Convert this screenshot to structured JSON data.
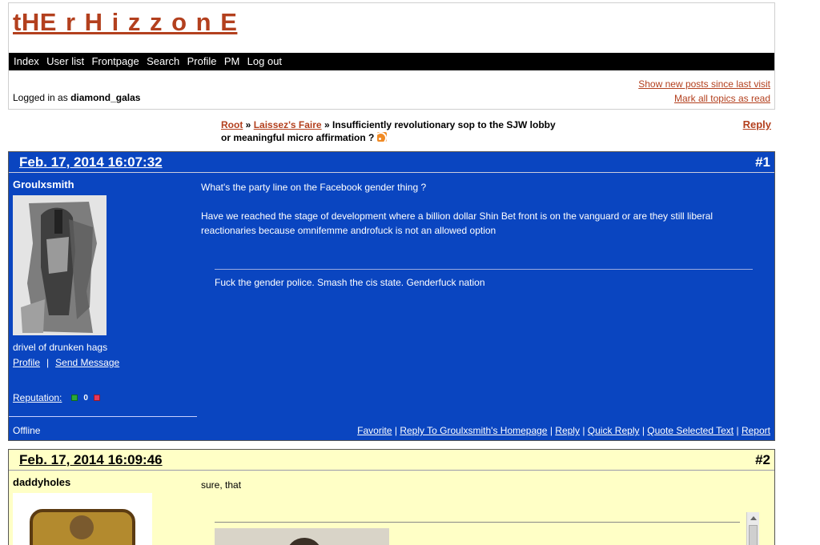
{
  "site": {
    "title": "tHE r H i z z o n E"
  },
  "nav": {
    "items": [
      "Index",
      "User list",
      "Frontpage",
      "Search",
      "Profile",
      "PM",
      "Log out"
    ]
  },
  "session": {
    "logged_in_prefix": "Logged in as",
    "username": "diamond_galas"
  },
  "quick_links": {
    "new_posts": "Show new posts since last visit",
    "mark_read": "Mark all topics as read"
  },
  "breadcrumb": {
    "root": "Root",
    "sep": "»",
    "forum": "Laissez's Faire",
    "topic": "Insufficiently revolutionary sop to the SJW lobby or meaningful micro affirmation ?"
  },
  "top_reply": "Reply",
  "posts": [
    {
      "date": "Feb. 17, 2014 16:07:32",
      "number": "#1",
      "author": "Groulxsmith",
      "user_title": "drivel of drunken hags",
      "profile_link": "Profile",
      "link_sep": "|",
      "message_link": "Send Message",
      "reputation_label": "Reputation:",
      "reputation_value": "0",
      "body": [
        "What's the party line on the Facebook gender thing ?",
        "Have we reached the stage of development where a billion dollar Shin Bet front is on the vanguard or are they still liberal reactionaries because omnifemme androfuck is not an allowed option"
      ],
      "signature": "Fuck the gender police. Smash the cis state. Genderfuck nation",
      "status": "Offline",
      "actions": [
        "Favorite",
        "Reply To Groulxsmith's Homepage",
        "Reply",
        "Quick Reply",
        "Quote Selected Text",
        "Report"
      ]
    },
    {
      "date": "Feb. 17, 2014 16:09:46",
      "number": "#2",
      "author": "daddyholes",
      "body": [
        "sure, that"
      ]
    }
  ]
}
